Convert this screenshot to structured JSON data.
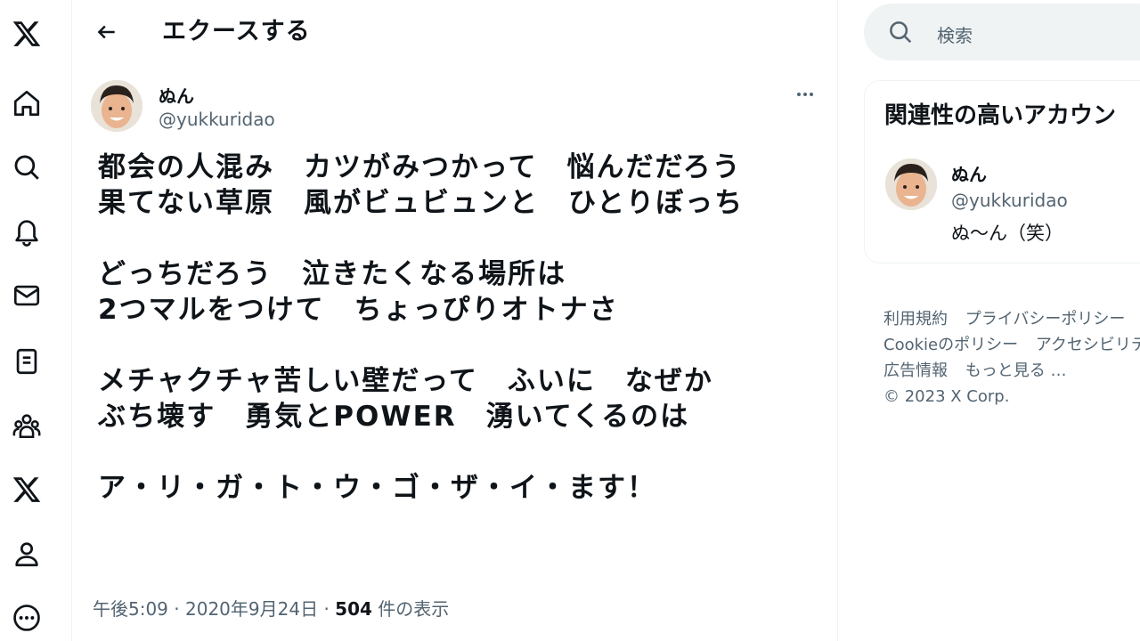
{
  "nav": {
    "items": [
      {
        "icon": "x-logo-icon"
      },
      {
        "icon": "home-icon"
      },
      {
        "icon": "search-icon"
      },
      {
        "icon": "bell-icon"
      },
      {
        "icon": "mail-icon"
      },
      {
        "icon": "list-icon"
      },
      {
        "icon": "communities-icon"
      },
      {
        "icon": "x-premium-icon"
      },
      {
        "icon": "profile-icon"
      },
      {
        "icon": "more-circle-icon"
      }
    ]
  },
  "header": {
    "back_icon": "arrow-left-icon",
    "title": "エクースする"
  },
  "tweet": {
    "author_name": "ぬん",
    "author_handle": "@yukkuridao",
    "text": "都会の人混み　カツがみつかって　悩んだだろう\n果てない草原　風がビュビュンと　ひとりぼっち\n\nどっちだろう　泣きたくなる場所は\n2つマルをつけて　ちょっぴりオトナさ\n\nメチャクチャ苦しい壁だって　ふいに　なぜか\nぶち壊す　勇気とPOWER　湧いてくるのは\n\nア・リ・ガ・ト・ウ・ゴ・ザ・イ・ます！",
    "time": "午後5:09",
    "date": "2020年9月24日",
    "sep": "·",
    "views_count": "504",
    "views_label": "件の表示"
  },
  "search": {
    "placeholder": "検索"
  },
  "related": {
    "title": "関連性の高いアカウン",
    "account": {
      "name": "ぬん",
      "handle": "@yukkuridao",
      "bio": "ぬ～ん（笑）"
    }
  },
  "footer": {
    "links": [
      "利用規約",
      "プライバシーポリシー",
      "Cookieのポリシー",
      "アクセシビリテ",
      "広告情報",
      "もっと見る …"
    ],
    "copyright": "© 2023 X Corp."
  },
  "colors": {
    "text": "#0f1419",
    "secondary": "#536471",
    "border": "#eff3f4"
  }
}
